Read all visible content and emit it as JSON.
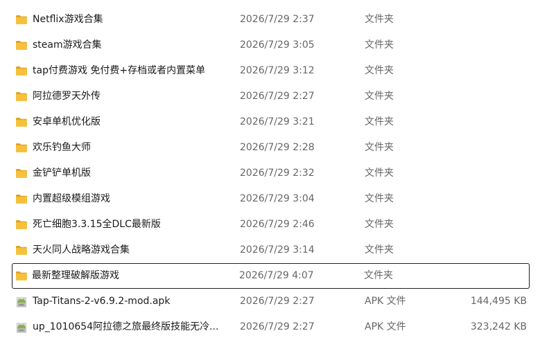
{
  "rows": [
    {
      "name": "Netflix游戏合集",
      "date": "2026/7/29 2:37",
      "type": "文件夹",
      "size": "",
      "icon": "folder-icon"
    },
    {
      "name": "steam游戏合集",
      "date": "2026/7/29 3:05",
      "type": "文件夹",
      "size": "",
      "icon": "folder-icon"
    },
    {
      "name": "tap付费游戏 免付费+存档或者内置菜单",
      "date": "2026/7/29 3:12",
      "type": "文件夹",
      "size": "",
      "icon": "folder-icon"
    },
    {
      "name": "阿拉德罗天外传",
      "date": "2026/7/29 2:27",
      "type": "文件夹",
      "size": "",
      "icon": "folder-icon"
    },
    {
      "name": "安卓单机优化版",
      "date": "2026/7/29 3:21",
      "type": "文件夹",
      "size": "",
      "icon": "folder-icon"
    },
    {
      "name": "欢乐钓鱼大师",
      "date": "2026/7/29 2:28",
      "type": "文件夹",
      "size": "",
      "icon": "folder-icon"
    },
    {
      "name": "金铲铲单机版",
      "date": "2026/7/29 2:32",
      "type": "文件夹",
      "size": "",
      "icon": "folder-icon"
    },
    {
      "name": "内置超级模组游戏",
      "date": "2026/7/29 3:04",
      "type": "文件夹",
      "size": "",
      "icon": "folder-icon"
    },
    {
      "name": "死亡细胞3.3.15全DLC最新版",
      "date": "2026/7/29 2:46",
      "type": "文件夹",
      "size": "",
      "icon": "folder-icon"
    },
    {
      "name": "天火同人战略游戏合集",
      "date": "2026/7/29 3:14",
      "type": "文件夹",
      "size": "",
      "icon": "folder-icon"
    },
    {
      "name": "最新整理破解版游戏",
      "date": "2026/7/29 4:07",
      "type": "文件夹",
      "size": "",
      "icon": "folder-icon",
      "selected": true
    },
    {
      "name": "Tap-Titans-2-v6.9.2-mod.apk",
      "date": "2026/7/29 2:27",
      "type": "APK 文件",
      "size": "144,495 KB",
      "icon": "apk-icon"
    },
    {
      "name": "up_1010654阿拉德之旅最终版技能无冷...",
      "date": "2026/7/29 2:27",
      "type": "APK 文件",
      "size": "323,242 KB",
      "icon": "apk-icon"
    }
  ],
  "colors": {
    "folder": "#f5c13d",
    "folder_dark": "#e0a423",
    "apk": "#8ab04a",
    "selected_border": "#1f1f1f"
  }
}
